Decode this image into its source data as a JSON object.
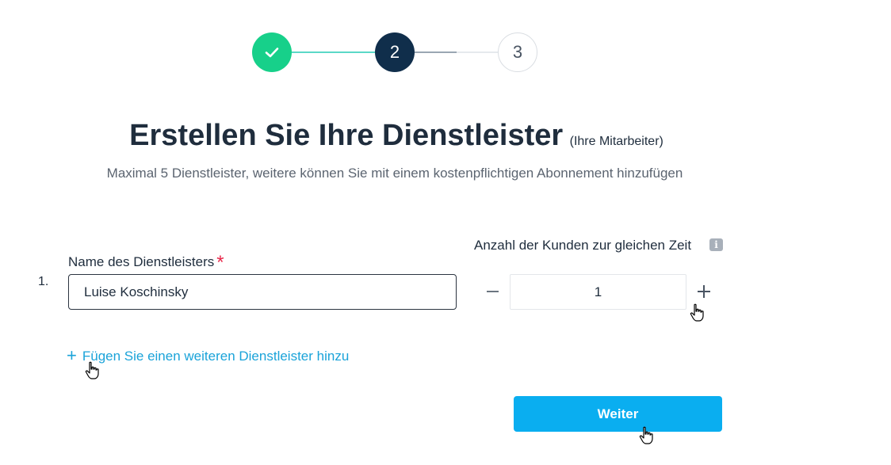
{
  "stepper": {
    "steps": [
      {
        "state": "completed",
        "label": "",
        "icon": "check-icon"
      },
      {
        "state": "active",
        "label": "2"
      },
      {
        "state": "upcoming",
        "label": "3"
      }
    ],
    "colors": {
      "completed": "#17d08a",
      "active": "#102e4b",
      "upcoming": "#ffffff"
    }
  },
  "header": {
    "title": "Erstellen Sie Ihre Dienstleister",
    "title_suffix": "(Ihre Mitarbeiter)",
    "subtitle": "Maximal 5 Dienstleister, weitere können Sie mit einem kostenpflichtigen Abonnement hinzufügen"
  },
  "form": {
    "rows": [
      {
        "index": "1.",
        "name_label": "Name des Dienstleisters",
        "required_marker": "*",
        "name_value": "Luise Koschinsky",
        "count_label": "Anzahl der Kunden zur gleichen Zeit",
        "count_value": "1",
        "info_icon": "info-icon",
        "info_glyph": "i"
      }
    ],
    "add_link_icon": "+",
    "add_link_label": "Fügen Sie einen weiteren Dienstleister hinzu"
  },
  "actions": {
    "next_label": "Weiter",
    "accent_color": "#0aaef0"
  }
}
